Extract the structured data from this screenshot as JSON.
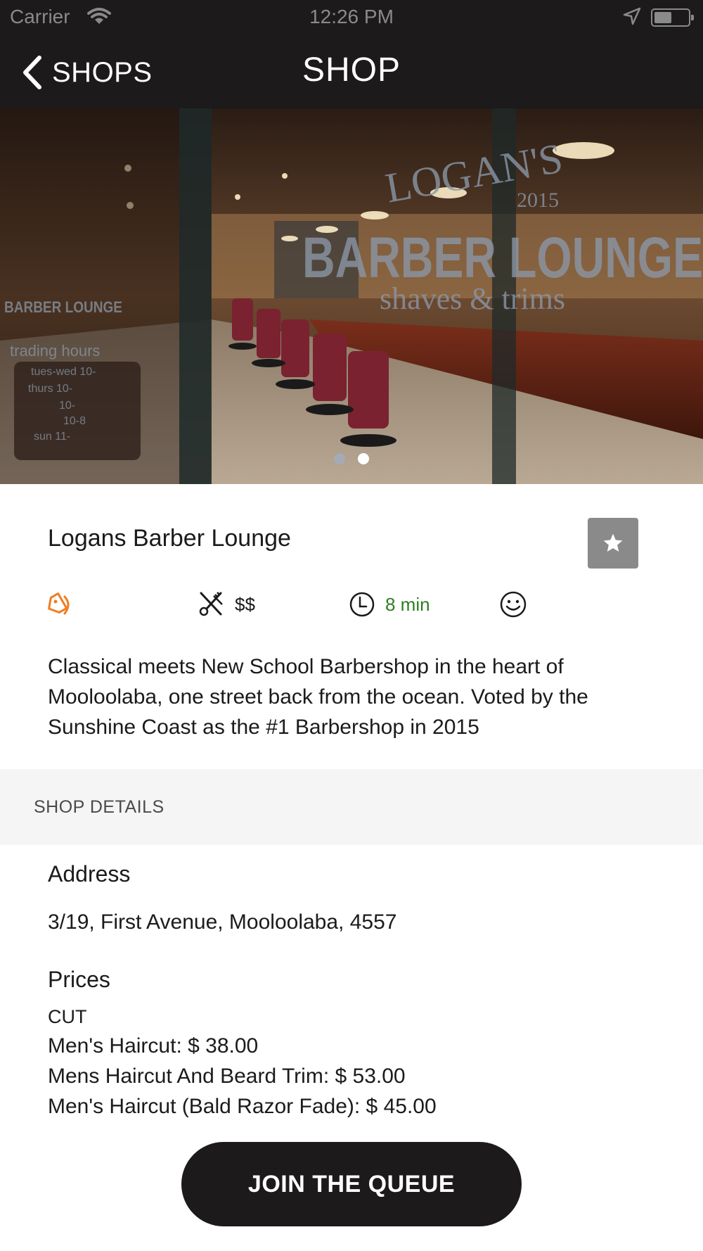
{
  "status_bar": {
    "carrier": "Carrier",
    "time": "12:26 PM"
  },
  "nav": {
    "back_label": "SHOPS",
    "title": "SHOP"
  },
  "hero": {
    "active_slide": 2,
    "slide_count": 2,
    "logo_text_line1": "LOGAN'S",
    "logo_text_year": "2015",
    "logo_text_line2": "BARBER LOUNGE",
    "logo_text_line3": "shaves & trims",
    "side_logo": "BARBER LOUNGE",
    "side_hours": [
      "trading hours",
      "tues-wed 10-",
      "thurs 10-",
      "10-",
      "10-8",
      "sun 11-"
    ]
  },
  "shop": {
    "name": "Logans Barber Lounge",
    "price_level": "$$",
    "wait_time": "8 min",
    "description": "Classical meets New School Barbershop in the heart of Mooloolaba, one street back from the ocean. Voted by the Sunshine Coast as the #1 Barbershop in 2015"
  },
  "details": {
    "section_label": "SHOP DETAILS",
    "address_label": "Address",
    "address": "3/19, First Avenue, Mooloolaba, 4557",
    "prices_label": "Prices",
    "category": "CUT",
    "prices": [
      "Men's Haircut: $ 38.00",
      "Mens Haircut And Beard Trim: $ 53.00",
      "Men's Haircut (Bald Razor Fade): $ 45.00"
    ]
  },
  "actions": {
    "join_label": "JOIN THE QUEUE"
  },
  "colors": {
    "bar": "#1c1a1a",
    "tag_icon": "#f07d22",
    "wait_time": "#2e7d22",
    "fav_button": "#8a8a8a"
  },
  "icons": [
    "chevron-left-icon",
    "wifi-icon",
    "location-arrow-icon",
    "battery-icon",
    "star-icon",
    "tag-icon",
    "scissors-comb-icon",
    "clock-icon",
    "smiley-icon"
  ]
}
